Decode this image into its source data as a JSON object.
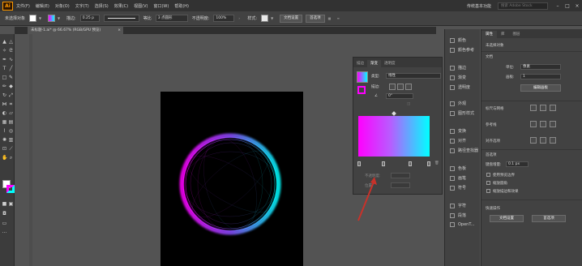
{
  "app": {
    "logo": "Ai"
  },
  "menu": [
    "文件(F)",
    "编辑(E)",
    "对象(O)",
    "文字(T)",
    "选择(S)",
    "效果(C)",
    "视图(V)",
    "窗口(W)",
    "帮助(H)"
  ],
  "menubar_right": {
    "workspace": "传统基本功能",
    "stock_search": "搜索 Adobe Stock"
  },
  "control_bar": {
    "no_selection": "未选择对象",
    "stroke_label": "描边:",
    "stroke_value": "0.25 p",
    "profile_label": "等比",
    "brush_value": "3 点圆形",
    "opacity_label": "不透明度:",
    "opacity_value": "100%",
    "style_label": "样式:",
    "doc_setup_button": "文档设置",
    "prefs_button": "首选项"
  },
  "document_tab": {
    "title": "未标题-1.ai* @ 66.67% (RGB/GPU 预览)",
    "close": "×"
  },
  "gradient_panel": {
    "tabs": [
      "描边",
      "渐变",
      "透明度"
    ],
    "active_tab": "渐变",
    "type_label": "类型:",
    "type_value": "线性",
    "stroke_label": "描边:",
    "angle_value": "0°",
    "opacity_label": "不透明度:",
    "location_label": "位置:",
    "gradient_colors": [
      "#ff00ff",
      "#00ffff"
    ]
  },
  "mid_panels": [
    {
      "name": "颜色"
    },
    {
      "name": "颜色参考"
    },
    {
      "name": "描边"
    },
    {
      "name": "渐变"
    },
    {
      "name": "透明度"
    },
    {
      "name": "外观"
    },
    {
      "name": "图形样式"
    },
    {
      "name": "变换"
    },
    {
      "name": "对齐"
    },
    {
      "name": "路径查找器"
    },
    {
      "name": "色板"
    },
    {
      "name": "画笔"
    },
    {
      "name": "符号"
    },
    {
      "name": "字符"
    },
    {
      "name": "段落"
    },
    {
      "name": "OpenT..."
    }
  ],
  "properties_panel": {
    "tabs": [
      "属性",
      "库",
      "图层"
    ],
    "no_selection": "未选择对象",
    "document_section": "文档",
    "units_label": "单位:",
    "units_value": "像素",
    "artboard_label": "画板:",
    "artboard_value": "1",
    "edit_artboard_button": "编辑画板",
    "snap_section": "标尺与网格",
    "guides_section": "参考线",
    "align_section": "对齐选项",
    "prefs_section": "首选项",
    "keyboard_increment_label": "键盘增量:",
    "keyboard_increment_value": "0.1 px",
    "cb_preview_bounds": "使用预览边界",
    "cb_scale_corners": "缩放圆角",
    "cb_scale_strokes": "缩放描边和效果",
    "quick_actions": "快速操作",
    "doc_setup_button": "文档设置",
    "prefs_button": "首选项"
  }
}
